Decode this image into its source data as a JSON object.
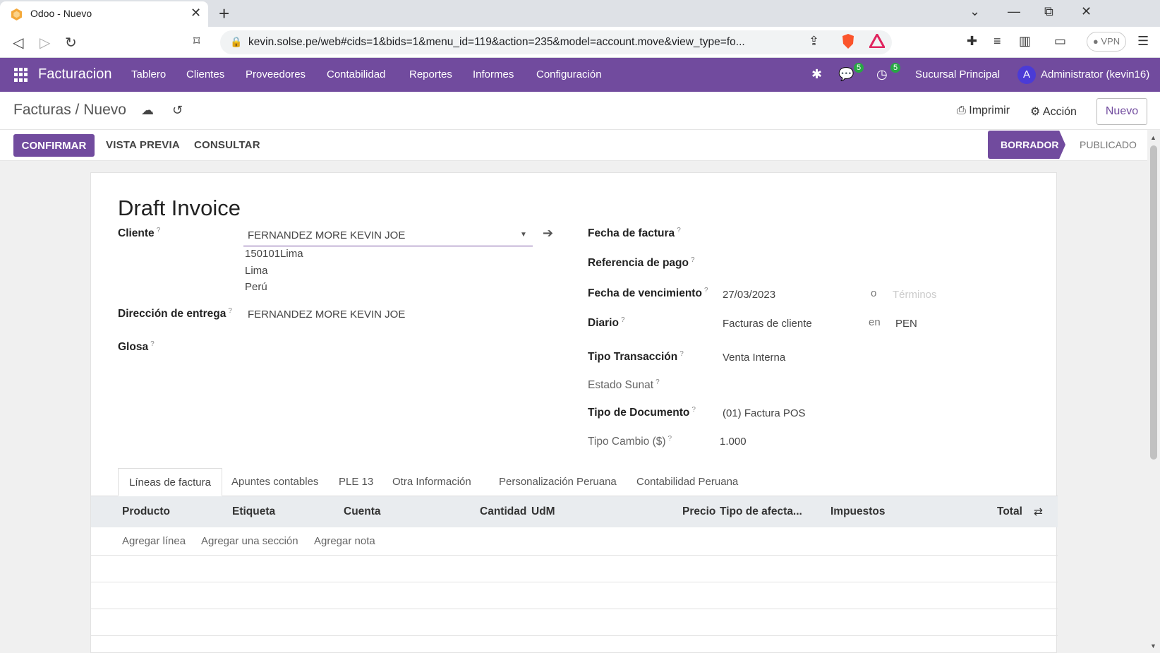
{
  "browser": {
    "tab_title": "Odoo - Nuevo",
    "tab_close": "✕",
    "new_tab": "+",
    "url": "kevin.solse.pe/web#cids=1&bids=1&menu_id=119&action=235&model=account.move&view_type=fo...",
    "vpn_label": "● VPN",
    "window_controls": {
      "minimize": "—",
      "restore": "⧉",
      "close": "✕",
      "dropdown": "⌄"
    }
  },
  "navbar": {
    "app_name": "Facturacion",
    "menu": [
      "Tablero",
      "Clientes",
      "Proveedores",
      "Contabilidad",
      "Reportes",
      "Informes",
      "Configuración"
    ],
    "messages_count": "5",
    "activities_count": "5",
    "company": "Sucursal Principal",
    "avatar_letter": "A",
    "user": "Administrator (kevin16)"
  },
  "control_panel": {
    "breadcrumb_parent": "Facturas",
    "breadcrumb_sep": "/",
    "breadcrumb_current": "Nuevo",
    "print_label": "Imprimir",
    "action_label": "Acción",
    "new_button": "Nuevo"
  },
  "statusbar": {
    "confirm": "CONFIRMAR",
    "preview": "VISTA PREVIA",
    "consult": "CONSULTAR",
    "stages": [
      "BORRADOR",
      "PUBLICADO"
    ],
    "active_stage": "BORRADOR"
  },
  "form": {
    "title": "Draft Invoice",
    "left": {
      "cliente_label": "Cliente",
      "cliente_value": "FERNANDEZ MORE KEVIN JOE",
      "address_lines": [
        "150101Lima",
        "Lima",
        "Perú"
      ],
      "entrega_label": "Dirección de entrega",
      "entrega_value": "FERNANDEZ MORE KEVIN JOE",
      "glosa_label": "Glosa"
    },
    "right": {
      "fecha_factura_label": "Fecha de factura",
      "referencia_label": "Referencia de pago",
      "vencimiento_label": "Fecha de vencimiento",
      "vencimiento_value": "27/03/2023",
      "vencimiento_or": "o",
      "terminos_placeholder": "Términos",
      "diario_label": "Diario",
      "diario_value": "Facturas de cliente",
      "diario_en": "en",
      "currency": "PEN",
      "tipo_transaccion_label": "Tipo Transacción",
      "tipo_transaccion_value": "Venta Interna",
      "estado_sunat_label": "Estado Sunat",
      "tipo_documento_label": "Tipo de Documento",
      "tipo_documento_value": "(01) Factura POS",
      "tipo_cambio_label": "Tipo Cambio ($)",
      "tipo_cambio_value": "1.000"
    },
    "help_mark": "?"
  },
  "notebook": {
    "tabs": [
      "Líneas de factura",
      "Apuntes contables",
      "PLE 13",
      "Otra Información",
      "Personalización Peruana",
      "Contabilidad Peruana"
    ],
    "active_tab": "Líneas de factura"
  },
  "lines_table": {
    "columns": [
      "Producto",
      "Etiqueta",
      "Cuenta",
      "Cantidad",
      "UdM",
      "Precio",
      "Tipo de afecta...",
      "Impuestos",
      "Total"
    ],
    "add_links": [
      "Agregar línea",
      "Agregar una sección",
      "Agregar nota"
    ]
  },
  "colors": {
    "brand": "#714b9e",
    "badge": "#28a745",
    "avatar": "#4b3bd6"
  },
  "icons": [
    "apps-grid-icon",
    "bug-icon",
    "chat-icon",
    "clock-icon",
    "cloud-upload-icon",
    "undo-icon",
    "print-icon",
    "gear-icon",
    "external-link-icon",
    "column-toggle-icon"
  ]
}
